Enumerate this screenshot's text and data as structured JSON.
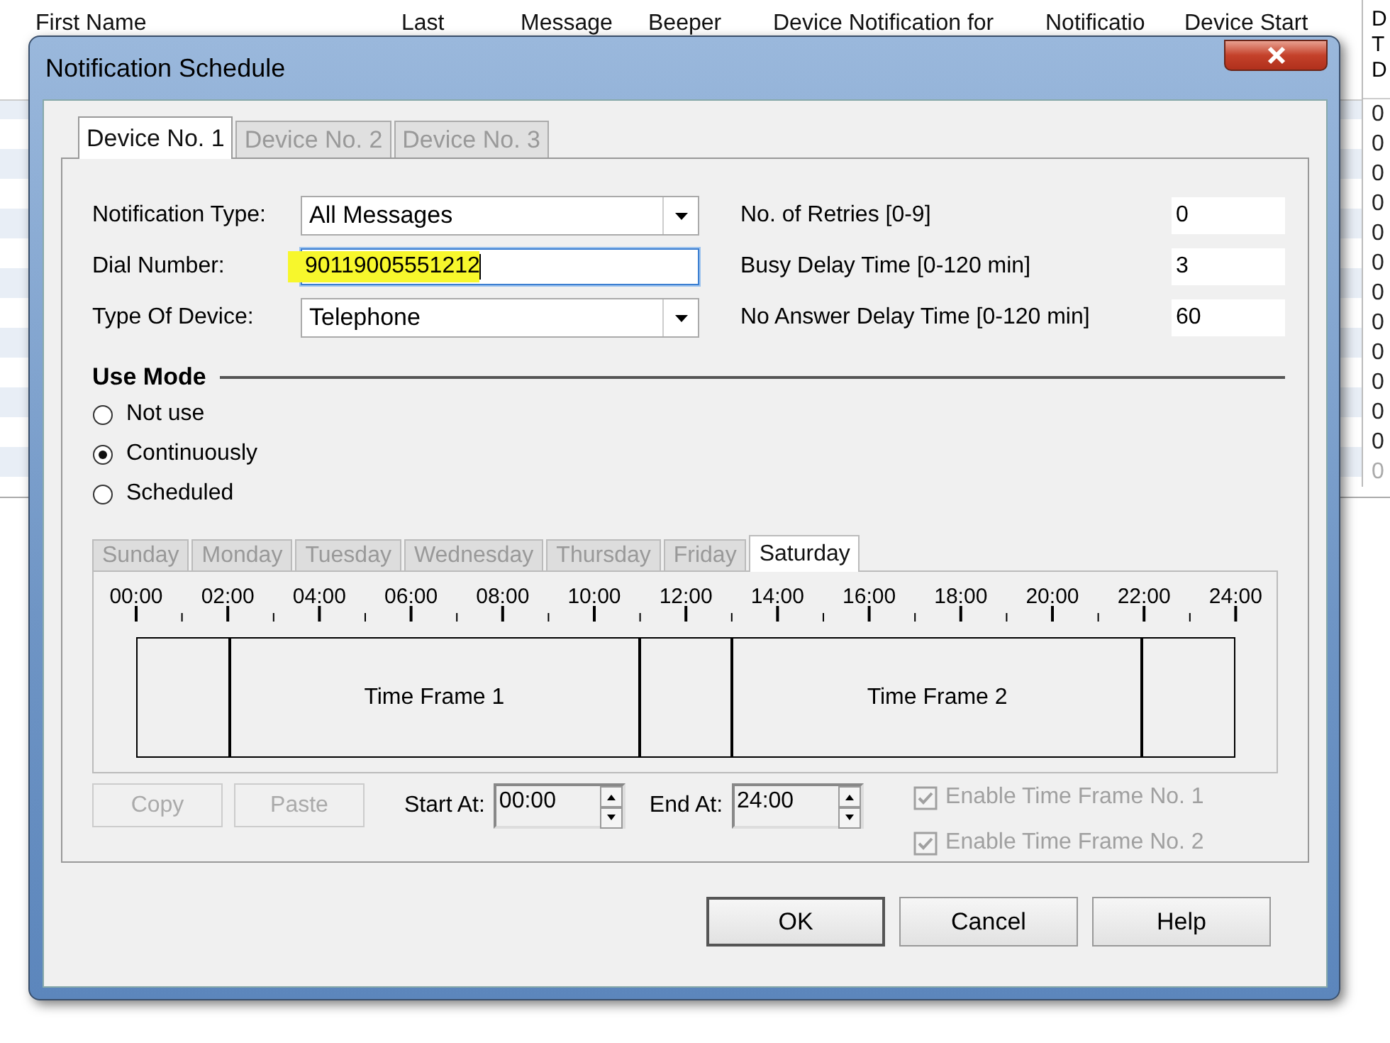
{
  "background_table": {
    "columns": [
      "First Name",
      "Last",
      "Message",
      "Beeper",
      "Device Notification for",
      "Notificatio",
      "Device Start"
    ],
    "edge_column": {
      "header_lines": [
        "D",
        "T",
        "D"
      ],
      "cells": [
        {
          "text": "0",
          "disabled": false
        },
        {
          "text": "0",
          "disabled": false
        },
        {
          "text": "0",
          "disabled": false
        },
        {
          "text": "0",
          "disabled": false
        },
        {
          "text": "0",
          "disabled": false
        },
        {
          "text": "0",
          "disabled": false
        },
        {
          "text": "0",
          "disabled": false
        },
        {
          "text": "0",
          "disabled": false
        },
        {
          "text": "0",
          "disabled": false
        },
        {
          "text": "0",
          "disabled": false
        },
        {
          "text": "0",
          "disabled": false
        },
        {
          "text": "0",
          "disabled": false
        },
        {
          "text": "0",
          "disabled": true
        }
      ]
    }
  },
  "window": {
    "title": "Notification Schedule"
  },
  "device_tabs": [
    {
      "label": "Device No. 1",
      "selected": true
    },
    {
      "label": "Device No. 2",
      "selected": false
    },
    {
      "label": "Device No. 3",
      "selected": false
    }
  ],
  "left_fields": [
    {
      "kind": "dropdown",
      "label": "Notification Type:",
      "value": "All Messages"
    },
    {
      "kind": "text",
      "label": "Dial Number:",
      "value": "90119005551212",
      "focused": true
    },
    {
      "kind": "dropdown",
      "label": "Type Of Device:",
      "value": "Telephone"
    }
  ],
  "right_fields": [
    {
      "label": "No. of Retries [0-9]",
      "value": "0"
    },
    {
      "label": "Busy Delay Time [0-120 min]",
      "value": "3"
    },
    {
      "label": "No Answer Delay Time [0-120 min]",
      "value": "60"
    }
  ],
  "use_mode": {
    "title": "Use Mode",
    "options": [
      {
        "label": "Not use",
        "selected": false
      },
      {
        "label": "Continuously",
        "selected": true
      },
      {
        "label": "Scheduled",
        "selected": false
      }
    ]
  },
  "day_tabs": [
    {
      "label": "Sunday",
      "selected": false
    },
    {
      "label": "Monday",
      "selected": false
    },
    {
      "label": "Tuesday",
      "selected": false
    },
    {
      "label": "Wednesday",
      "selected": false
    },
    {
      "label": "Thursday",
      "selected": false
    },
    {
      "label": "Friday",
      "selected": false
    },
    {
      "label": "Saturday",
      "selected": true
    }
  ],
  "timeline": {
    "axis_labels": [
      "00:00",
      "02:00",
      "04:00",
      "06:00",
      "08:00",
      "10:00",
      "12:00",
      "14:00",
      "16:00",
      "18:00",
      "20:00",
      "22:00",
      "24:00"
    ],
    "segments": [
      {
        "kind": "gap"
      },
      {
        "kind": "frame",
        "label": "Time Frame 1"
      },
      {
        "kind": "gap"
      },
      {
        "kind": "frame",
        "label": "Time Frame 2"
      },
      {
        "kind": "gap"
      }
    ]
  },
  "edit_buttons": [
    {
      "label": "Copy",
      "disabled": true
    },
    {
      "label": "Paste",
      "disabled": true
    }
  ],
  "start_at": {
    "label": "Start At:",
    "value": "00:00"
  },
  "end_at": {
    "label": "End At:",
    "value": "24:00"
  },
  "enable_checkboxes": [
    {
      "label": "Enable Time Frame No. 1",
      "checked": true,
      "disabled": true
    },
    {
      "label": "Enable Time Frame No. 2",
      "checked": true,
      "disabled": true
    }
  ],
  "buttons": [
    {
      "label": "OK",
      "default": true
    },
    {
      "label": "Cancel",
      "default": false
    },
    {
      "label": "Help",
      "default": false
    }
  ]
}
